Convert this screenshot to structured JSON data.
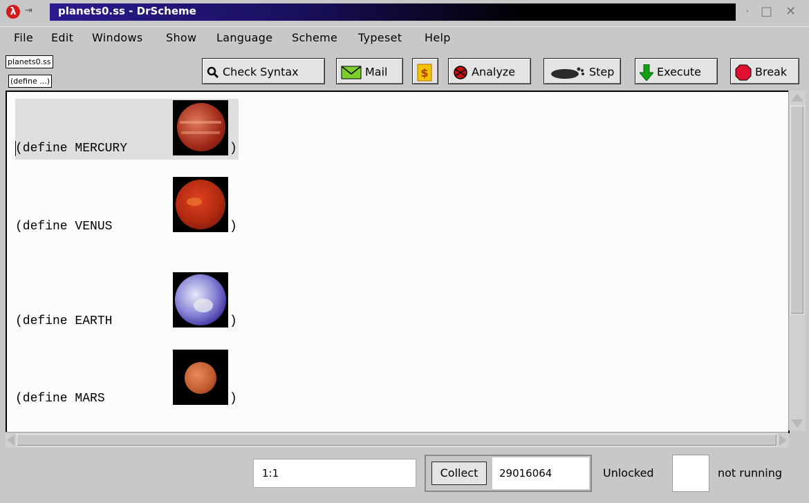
{
  "window": {
    "title": "planets0.ss - DrScheme",
    "app_icon_glyph": "λ",
    "pin_glyph": "⇥",
    "controls": {
      "minimize": "·",
      "maximize": "□",
      "close": "✕"
    }
  },
  "menu": [
    "File",
    "Edit",
    "Windows",
    "Show",
    "Language",
    "Scheme",
    "Typeset",
    "Help"
  ],
  "toolbar": {
    "file_label": "planets0.ss",
    "define_label": "(define ...)",
    "buttons": {
      "check_syntax": "Check Syntax",
      "mail": "Mail",
      "analyze": "Analyze",
      "step": "Step",
      "execute": "Execute",
      "break": "Break"
    },
    "icons": {
      "check_syntax": "magnifier-icon",
      "mail": "envelope-icon",
      "money": "dollar-icon",
      "analyze": "spider-icon",
      "step": "footprint-icon",
      "execute": "down-arrow-icon",
      "break": "stop-icon"
    }
  },
  "editor": {
    "lines": [
      {
        "code": "(define MERCURY ",
        "close": ")",
        "planet": "jupiter-like-image"
      },
      {
        "code": "(define VENUS   ",
        "close": ")",
        "planet": "red-planet-image"
      },
      {
        "code": "(define EARTH   ",
        "close": ")",
        "planet": "earth-image"
      },
      {
        "code": "(define MARS    ",
        "close": ")",
        "planet": "mars-image"
      }
    ]
  },
  "status": {
    "position": "1:1",
    "collect_label": "Collect",
    "memory": "29016064",
    "lock_state": "Unlocked",
    "run_state": "not running"
  },
  "colors": {
    "title_gradient_start": "#2a1b8e",
    "title_gradient_end": "#000000",
    "editor_bg": "#fafcfa",
    "chrome_bg": "#c8c8c8"
  }
}
